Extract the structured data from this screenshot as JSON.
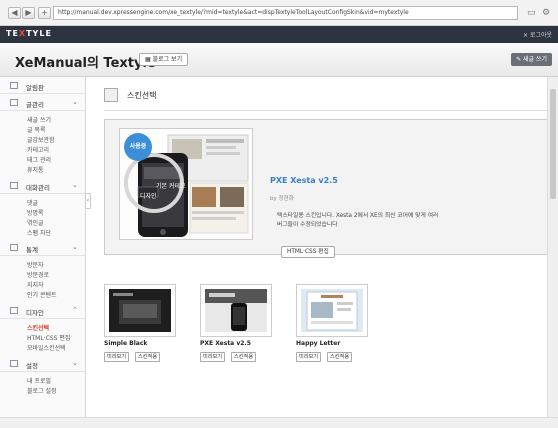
{
  "browser": {
    "url": "http://manual.dev.xpressengine.com/xe_textyle/?mid=textyle&act=dispTextyleToolLayoutConfigSkin&vid=mytextyle",
    "back_label": "◀",
    "forward_label": "▶",
    "add_label": "+"
  },
  "app": {
    "logo_pre": "TE",
    "logo_x": "X",
    "logo_post": "TYLE",
    "logout": "× 로그아웃",
    "blog_title": "XeManual의 Textyle",
    "blog_view": "블로그 보기",
    "write_post": "새글 쓰기"
  },
  "sidebar": {
    "dashboard": "알림판",
    "posts": {
      "label": "글관리",
      "items": [
        "새글 쓰기",
        "글 목록",
        "글감보관함",
        "카테고리",
        "태그 관리",
        "휴지통"
      ]
    },
    "comments": {
      "label": "대화관리",
      "items": [
        "댓글",
        "방명록",
        "엮인글",
        "스팸 차단"
      ]
    },
    "stats": {
      "label": "통계",
      "items": [
        "방문자",
        "방문경로",
        "지지자",
        "인기 콘텐트"
      ]
    },
    "design": {
      "label": "디자인",
      "items": [
        "스킨선택",
        "HTML·CSS 편집",
        "모바일스킨선택"
      ]
    },
    "settings": {
      "label": "설정",
      "items": [
        "내 프로필",
        "블로그 설정"
      ]
    }
  },
  "main": {
    "page_title": "스킨선택",
    "current": {
      "badge": "사용중",
      "name": "PXE Xesta v2.5",
      "by_label": "by",
      "author": "정현화",
      "description": "텍스타일용 스킨입니다. Xesta 2에서 XE의 최신 코어에 맞게 여러 버그들이 수정되었습니다",
      "edit_button": "HTML·CSS 편집",
      "thumb_caption_1": "기본 커테고",
      "thumb_caption_2": "디자인"
    },
    "themes": [
      {
        "name": "Simple Black",
        "preview": "미리보기",
        "apply": "스킨적용"
      },
      {
        "name": "PXE Xesta v2.5",
        "preview": "미리보기",
        "apply": "스킨적용"
      },
      {
        "name": "Happy Letter",
        "preview": "미리보기",
        "apply": "스킨적용"
      }
    ]
  },
  "colors": {
    "accent": "#d63a2d",
    "link": "#3b7ec7",
    "badge": "#3c8fd6",
    "header_dark": "#2e3340"
  }
}
